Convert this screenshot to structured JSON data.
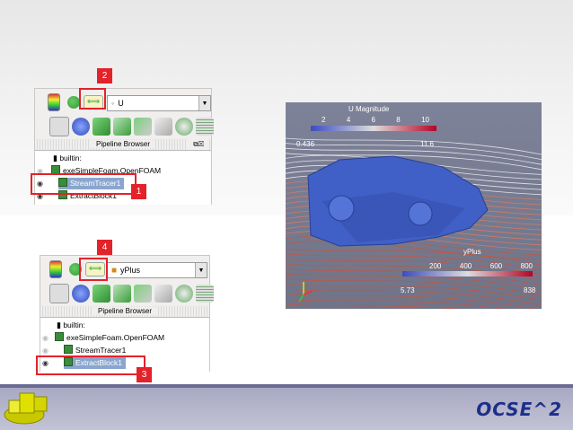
{
  "panel_top": {
    "combo_value": "U",
    "pipeline_title": "Pipeline Browser",
    "tree": [
      "builtin:",
      "exeSimpleFoam.OpenFOAM",
      "StreamTracer1",
      "ExtractBlock1"
    ],
    "callouts": [
      "2",
      "1"
    ]
  },
  "panel_bottom": {
    "combo_value": "yPlus",
    "pipeline_title": "Pipeline Browser",
    "tree": [
      "builtin:",
      "exeSimpleFoam.OpenFOAM",
      "StreamTracer1",
      "ExtractBlock1"
    ],
    "callouts": [
      "4",
      "3"
    ]
  },
  "render_view": {
    "u_bar": {
      "title": "U Magnitude",
      "ticks": [
        "2",
        "4",
        "6",
        "8",
        "10"
      ],
      "min": "0.436",
      "max": "11.6"
    },
    "yplus_bar": {
      "title": "yPlus",
      "ticks": [
        "200",
        "400",
        "600",
        "800"
      ],
      "min": "5.73",
      "max": "838"
    }
  },
  "footer": {
    "brand": "OCSE^2"
  },
  "colors": {
    "accent_red": "#e3222a",
    "selection": "#8aa6cf",
    "brand_blue": "#1e2f8a"
  }
}
